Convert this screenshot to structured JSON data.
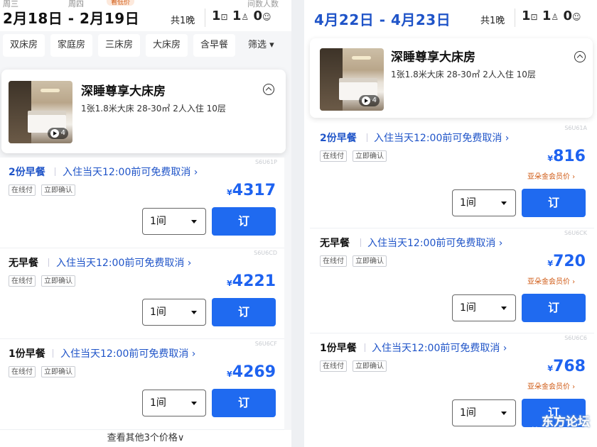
{
  "left": {
    "weekday_in": "周三",
    "weekday_out": "周四",
    "low_price_tag": "看低价",
    "dates": "2月18日 - 2月19日",
    "nights": "共1晚",
    "hint": "间数人数",
    "rooms": "1",
    "adults": "1",
    "children": "0",
    "filters": [
      "双床房",
      "家庭房",
      "三床房",
      "大床房",
      "含早餐",
      "筛选"
    ],
    "room": {
      "title": "深睡尊享大床房",
      "desc": "1张1.8米大床  28-30㎡  2人入住  10层",
      "media_count": "4"
    },
    "rates": [
      {
        "code": "S6U61P",
        "meal": "2份早餐",
        "cancel": "入住当天12:00前可免费取消 ›",
        "tags": [
          "在线付",
          "立即确认"
        ],
        "currency": "¥",
        "price": "4317",
        "qty": "1间",
        "book": "订"
      },
      {
        "code": "S6U6CD",
        "meal": "无早餐",
        "cancel": "入住当天12:00前可免费取消 ›",
        "tags": [
          "在线付",
          "立即确认"
        ],
        "currency": "¥",
        "price": "4221",
        "qty": "1间",
        "book": "订"
      },
      {
        "code": "S6U6CF",
        "meal": "1份早餐",
        "cancel": "入住当天12:00前可免费取消 ›",
        "tags": [
          "在线付",
          "立即确认"
        ],
        "currency": "¥",
        "price": "4269",
        "qty": "1间",
        "book": "订"
      }
    ],
    "more": "查看其他3个价格∨"
  },
  "right": {
    "dates": "4月22日 - 4月23日",
    "nights": "共1晚",
    "rooms": "1",
    "adults": "1",
    "children": "0",
    "room": {
      "title": "深睡尊享大床房",
      "desc": "1张1.8米大床  28-30㎡  2人入住  10层",
      "media_count": "4"
    },
    "rates": [
      {
        "code": "S6U61A",
        "meal": "2份早餐",
        "cancel": "入住当天12:00前可免费取消 ›",
        "tags": [
          "在线付",
          "立即确认"
        ],
        "currency": "¥",
        "price": "816",
        "member": "亚朵金会员价 ›",
        "qty": "1间",
        "book": "订"
      },
      {
        "code": "S6U6CK",
        "meal": "无早餐",
        "cancel": "入住当天12:00前可免费取消 ›",
        "tags": [
          "在线付",
          "立即确认"
        ],
        "currency": "¥",
        "price": "720",
        "member": "亚朵金会员价 ›",
        "qty": "1间",
        "book": "订"
      },
      {
        "code": "S6U6C6",
        "meal": "1份早餐",
        "cancel": "入住当天12:00前可免费取消 ›",
        "tags": [
          "在线付",
          "立即确认"
        ],
        "currency": "¥",
        "price": "768",
        "member": "亚朵金会员价 ›",
        "qty": "1间",
        "book": "订"
      }
    ]
  },
  "watermark": {
    "name": "东方论坛",
    "url": "bbs.eastday.com"
  },
  "colors": {
    "accent": "#1f6af0",
    "price": "#1d62f0",
    "member": "#d05a14"
  }
}
